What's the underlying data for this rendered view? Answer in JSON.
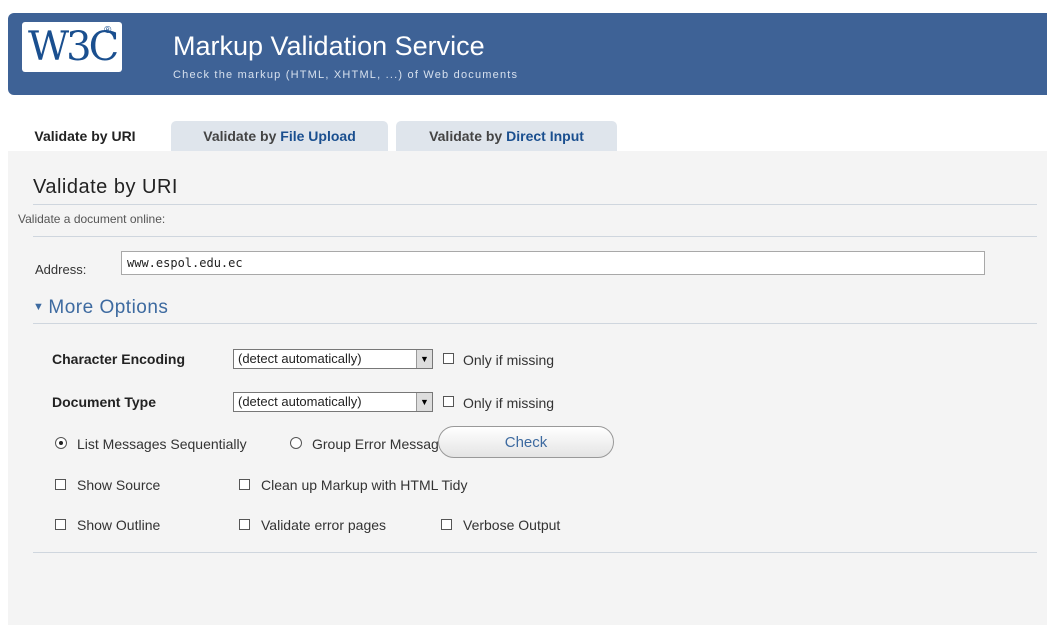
{
  "banner": {
    "logo_text": "W3C",
    "logo_mark": "®",
    "title": "Markup Validation Service",
    "subtitle": "Check the markup (HTML, XHTML, ...) of Web documents"
  },
  "tabs": [
    {
      "prefix": "Validate by ",
      "emph": "URI",
      "active": true
    },
    {
      "prefix": "Validate by ",
      "emph": "File Upload",
      "active": false
    },
    {
      "prefix": "Validate by ",
      "emph": "Direct Input",
      "active": false
    }
  ],
  "section": {
    "title": "Validate by URI",
    "subtext": "Validate a document online:",
    "address_label": "Address:",
    "address_value": "www.espol.edu.ec"
  },
  "more_options": {
    "label": "More Options",
    "icon": "triangle-down-icon"
  },
  "options": {
    "char_encoding": {
      "label": "Character Encoding",
      "value": "(detect automatically)",
      "only_if_missing_label": "Only if missing",
      "only_if_missing": false
    },
    "doc_type": {
      "label": "Document Type",
      "value": "(detect automatically)",
      "only_if_missing_label": "Only if missing",
      "only_if_missing": false
    },
    "list_sequential": {
      "label": "List Messages Sequentially",
      "selected": true
    },
    "group_by_type": {
      "label": "Group Error Messages by type",
      "selected": false
    },
    "show_source": {
      "label": "Show Source",
      "checked": false
    },
    "clean_up": {
      "label": "Clean up Markup with HTML Tidy",
      "checked": false
    },
    "show_outline": {
      "label": "Show Outline",
      "checked": false
    },
    "validate_error_pages": {
      "label": "Validate error pages",
      "checked": false
    },
    "verbose_output": {
      "label": "Verbose Output",
      "checked": false
    }
  },
  "check_button": "Check",
  "colors": {
    "banner": "#3e6296",
    "accent": "#3d6aa0",
    "panel": "#f4f4f4"
  }
}
